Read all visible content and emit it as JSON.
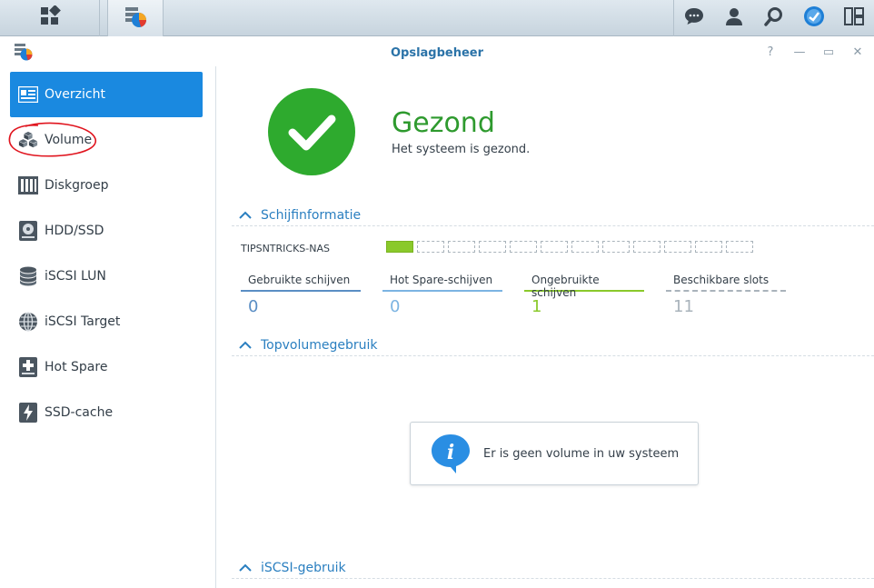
{
  "window": {
    "title": "Opslagbeheer"
  },
  "taskbar": {
    "left_icons": [
      "main-menu-icon",
      "storage-manager-icon"
    ],
    "right_icons": [
      "chat-icon",
      "user-icon",
      "search-icon",
      "notification-icon",
      "widgets-icon"
    ]
  },
  "sidebar": {
    "items": [
      {
        "label": "Overzicht",
        "icon": "overview-icon",
        "active": true
      },
      {
        "label": "Volume",
        "icon": "volume-icon",
        "active": false
      },
      {
        "label": "Diskgroep",
        "icon": "diskgroup-icon",
        "active": false
      },
      {
        "label": "HDD/SSD",
        "icon": "hdd-icon",
        "active": false
      },
      {
        "label": "iSCSI LUN",
        "icon": "iscsi-lun-icon",
        "active": false
      },
      {
        "label": "iSCSI Target",
        "icon": "iscsi-target-icon",
        "active": false
      },
      {
        "label": "Hot Spare",
        "icon": "hot-spare-icon",
        "active": false
      },
      {
        "label": "SSD-cache",
        "icon": "ssd-cache-icon",
        "active": false
      }
    ]
  },
  "health": {
    "status": "Gezond",
    "description": "Het systeem is gezond."
  },
  "sections": {
    "disk_info": "Schijfinformatie",
    "top_volume": "Topvolumegebruik",
    "iscsi": "iSCSI-gebruik"
  },
  "disk": {
    "name": "TIPSNTRICKS-NAS",
    "slots_used": 1,
    "slots_total": 12
  },
  "stats": [
    {
      "label": "Gebruikte schijven",
      "value": "0"
    },
    {
      "label": "Hot Spare-schijven",
      "value": "0"
    },
    {
      "label": "Ongebruikte schijven",
      "value": "1"
    },
    {
      "label": "Beschikbare slots",
      "value": "11"
    }
  ],
  "empty_volume_message": "Er is geen volume in uw systeem",
  "colors": {
    "accent": "#1a89e0",
    "healthy": "#2eaa2e",
    "section_title": "#2a7fc0",
    "unused_disk": "#8ac92b"
  }
}
